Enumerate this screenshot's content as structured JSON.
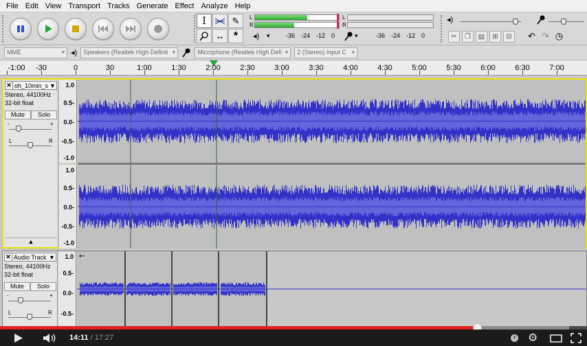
{
  "menu": [
    "File",
    "Edit",
    "View",
    "Transport",
    "Tracks",
    "Generate",
    "Effect",
    "Analyze",
    "Help"
  ],
  "meters": {
    "left_label": "L",
    "right_label": "R",
    "play_ticks": [
      "-36",
      "-24",
      "-12",
      "0"
    ],
    "rec_ticks": [
      "-36",
      "-24",
      "-12",
      "0"
    ],
    "play_level_left": 0.62,
    "play_level_right": 0.47
  },
  "devices": {
    "host": "MME",
    "output": "Speakers (Realtek High Definit",
    "input": "Microphone (Realtek High Defi",
    "channels": "2 (Stereo) Input C"
  },
  "ruler": {
    "labels": [
      "-1:00",
      "-30",
      "0",
      "30",
      "1:00",
      "1:30",
      "2:00",
      "2:30",
      "3:00",
      "3:30",
      "4:00",
      "4:30",
      "5:00",
      "5:30",
      "6:00",
      "6:30",
      "7:00"
    ]
  },
  "track1": {
    "name": "oh_10min_s",
    "format": "Stereo, 44100Hz",
    "bitdepth": "32-bit float",
    "mute": "Mute",
    "solo": "Solo",
    "pan_l": "L",
    "pan_r": "R",
    "gain_minus": "-",
    "gain_plus": "+",
    "scale": [
      "1.0",
      "0.5-",
      "0.0-",
      "-0.5-",
      "-1.0"
    ]
  },
  "track1b": {
    "scale": [
      "1.0",
      "0.5-",
      "0.0-",
      "-0.5-",
      "-1.0"
    ]
  },
  "track2": {
    "name": "Audio Track",
    "format": "Stereo, 44100Hz",
    "bitdepth": "32-bit float",
    "mute": "Mute",
    "solo": "Solo",
    "pan_l": "L",
    "pan_r": "R",
    "gain_minus": "-",
    "gain_plus": "+",
    "scale": [
      "1.0",
      "0.5-",
      "0.0-",
      "-0.5-"
    ]
  },
  "player": {
    "current": "14:11",
    "separator": " / ",
    "duration": "17:27",
    "progress": 0.8128,
    "buffered": 0.97
  },
  "colors": {
    "wave": "#3232c8",
    "wave_inner": "#6464dc",
    "selection": "#e8e300",
    "played": "#e41f1f"
  }
}
